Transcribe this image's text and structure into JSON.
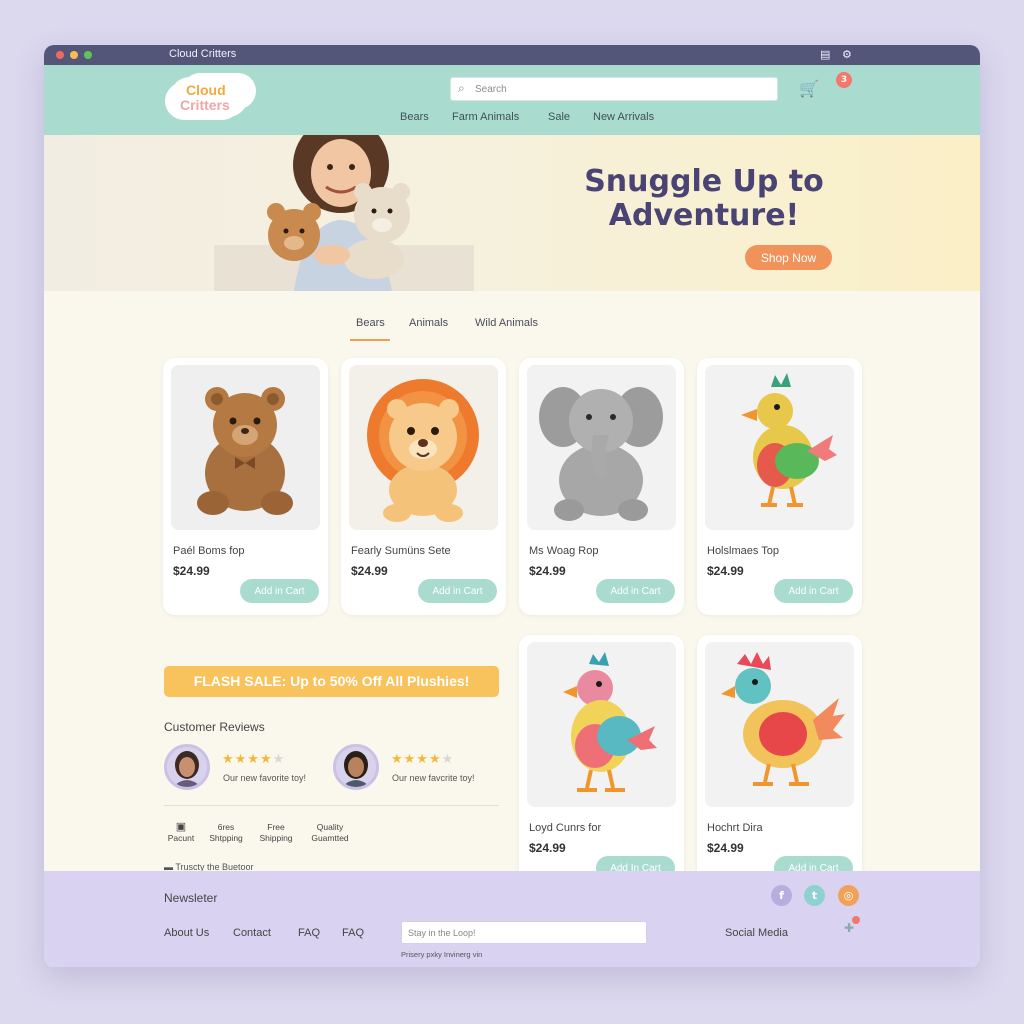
{
  "window": {
    "title": "Cloud Critters"
  },
  "brand": {
    "line1": "Cloud",
    "line2": "Critters"
  },
  "search": {
    "placeholder": "Search"
  },
  "cart": {
    "count": "3"
  },
  "nav": [
    "Bears",
    "Farm Animals",
    "Sale",
    "New Arrivals"
  ],
  "hero": {
    "title": "Snuggle Up to Adventure!",
    "cta": "Shop Now"
  },
  "category_tabs": [
    "Bears",
    "Animals",
    "Wild Animals"
  ],
  "products": [
    {
      "name": "Paél Boms fop",
      "price": "$24.99",
      "cta": "Add in Cart",
      "image": "teddy-bear"
    },
    {
      "name": "Fearly Sumüns Sete",
      "price": "$24.99",
      "cta": "Add in Cart",
      "image": "lion"
    },
    {
      "name": "Ms Woag Rop",
      "price": "$24.99",
      "cta": "Add in Cart",
      "image": "elephant"
    },
    {
      "name": "Holslmaes Top",
      "price": "$24.99",
      "cta": "Add in Cart",
      "image": "parrot"
    },
    {
      "name": "Loyd Cunrs for",
      "price": "$24.99",
      "cta": "Add In Cart",
      "image": "parrot"
    },
    {
      "name": "Hochrt Dira",
      "price": "$24.99",
      "cta": "Add in Cart",
      "image": "rooster"
    }
  ],
  "flash_sale": "FLASH SALE: Up to 50% Off All Plushies!",
  "reviews": {
    "title": "Customer Reviews",
    "items": [
      {
        "text": "Our new favorite toy!",
        "rating": 4
      },
      {
        "text": "Our new favcrite toy!",
        "rating": 4
      }
    ]
  },
  "features": [
    {
      "line1": "",
      "line2": "Pacunt"
    },
    {
      "line1": "6res",
      "line2": "Shtpping"
    },
    {
      "line1": "Free",
      "line2": "Shipping"
    },
    {
      "line1": "Quality",
      "line2": "Guamtted"
    }
  ],
  "trust": "Truscty the Buetoor",
  "footer": {
    "newsletter": "Newsleter",
    "links": [
      "About Us",
      "Contact",
      "FAQ",
      "FAQ"
    ],
    "email_placeholder": "Stay in the Loop!",
    "privacy": "Prisery pxky Invinerg vin",
    "social_label": "Social Media"
  },
  "colors": {
    "header": "#a9dccf",
    "accent": "#f0925a",
    "footer": "#d9d3f1",
    "flash": "#f8c25c",
    "titlebar": "#545679"
  }
}
